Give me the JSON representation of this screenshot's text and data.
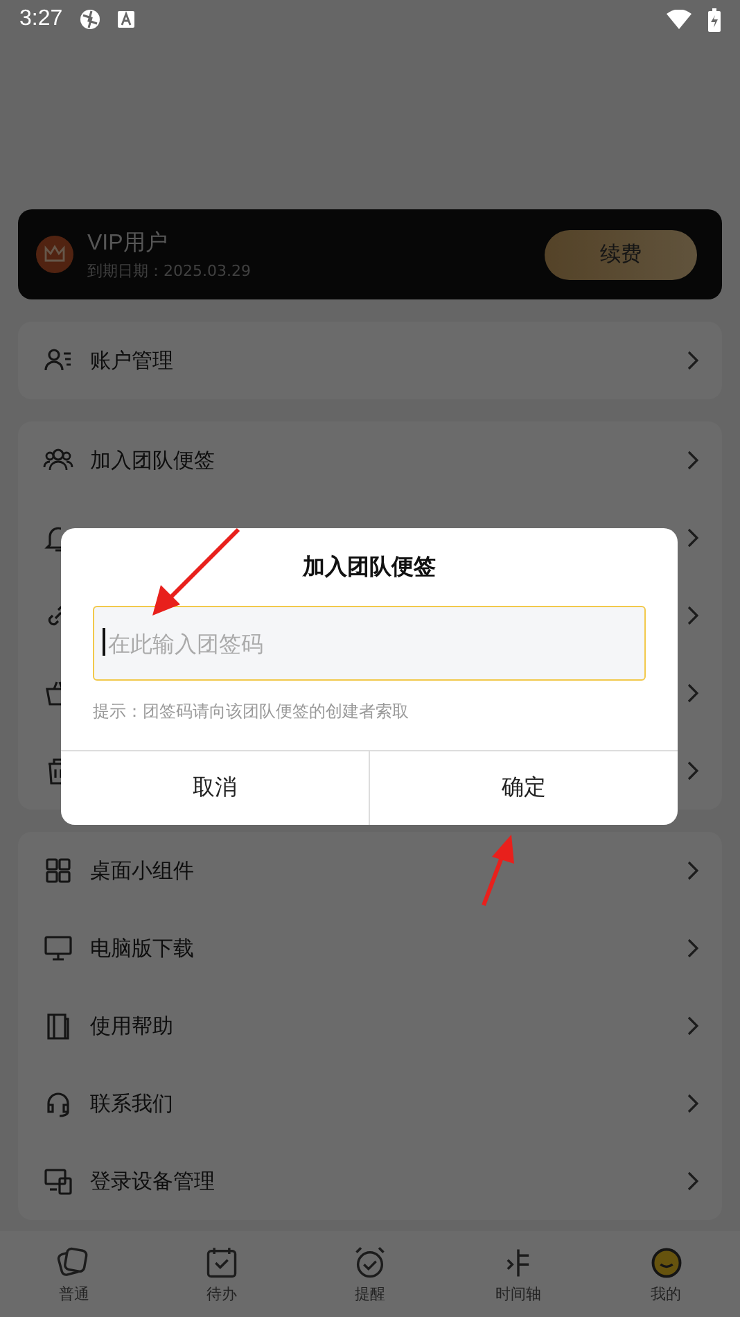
{
  "status_bar": {
    "time": "3:27"
  },
  "vip_card": {
    "title": "VIP用户",
    "expiry": "到期日期：2025.03.29",
    "button": "续费"
  },
  "sections": [
    {
      "items": [
        {
          "label": "账户管理"
        }
      ]
    },
    {
      "items": [
        {
          "label": "加入团队便签"
        }
      ]
    },
    {
      "items": [
        {
          "label": "桌面小组件"
        },
        {
          "label": "电脑版下载"
        },
        {
          "label": "使用帮助"
        },
        {
          "label": "联系我们"
        },
        {
          "label": "登录设备管理"
        }
      ]
    }
  ],
  "bottom_nav": [
    {
      "label": "普通"
    },
    {
      "label": "待办"
    },
    {
      "label": "提醒"
    },
    {
      "label": "时间轴"
    },
    {
      "label": "我的"
    }
  ],
  "dialog": {
    "title": "加入团队便签",
    "placeholder": "在此输入团签码",
    "hint": "提示：团签码请向该团队便签的创建者索取",
    "buttons": [
      "取消",
      "确定"
    ]
  }
}
